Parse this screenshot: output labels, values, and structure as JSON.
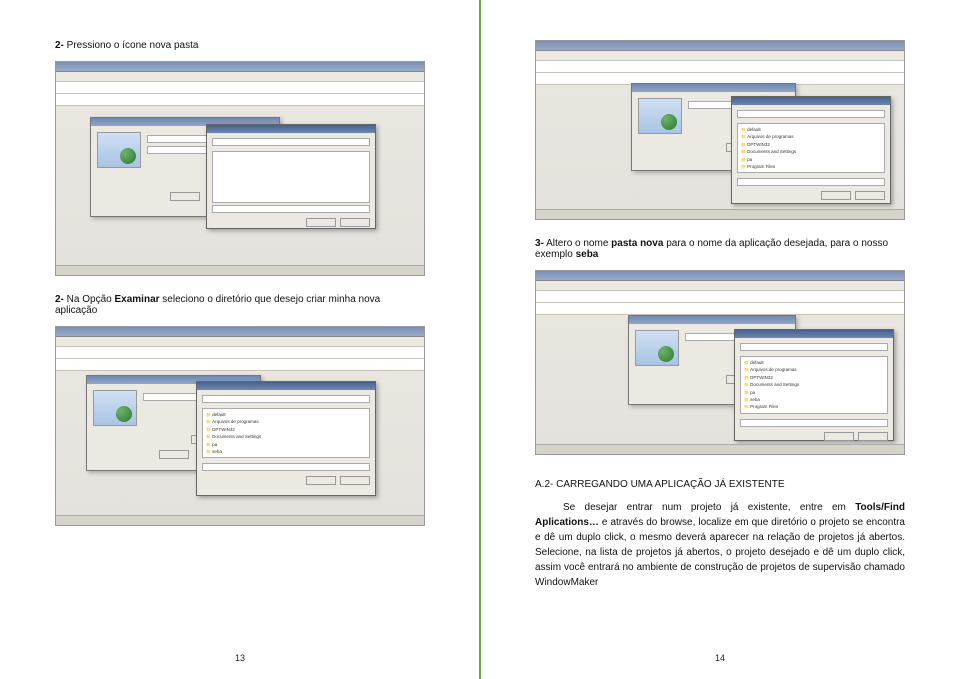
{
  "left": {
    "step2": {
      "num": "2-",
      "text": " Pressiono o ícone nova pasta"
    },
    "step2b_prefix": "2-",
    "step2b_mid1": " Na Opção ",
    "step2b_bold": "Examinar",
    "step2b_mid2": " seleciono o diretório que desejo criar minha nova aplicação",
    "page_num": "13"
  },
  "right": {
    "step3_prefix": "3-",
    "step3_mid1": " Altero o nome ",
    "step3_bold1": "pasta nova",
    "step3_mid2": " para o nome da aplicação desejada, para o nosso exemplo ",
    "step3_bold2": "seba",
    "section_heading": "A.2- CARREGANDO UMA APLICAÇÃO JÁ EXISTENTE",
    "paragraph_p1": "Se desejar entrar num projeto já existente, entre em ",
    "paragraph_b1": "Tools/Find Aplications…",
    "paragraph_p2": " e através do browse, localize em que diretório o projeto se encontra e dê um duplo click, o mesmo deverá aparecer na relação de projetos já abertos. Selecione, na lista de projetos já abertos, o projeto desejado e dê um duplo click, assim você entrará no ambiente de construção de projetos de supervisão chamado WindowMaker",
    "page_num": "14"
  },
  "dir_list": {
    "items": [
      "default",
      "Arquivos de programas",
      "DPTWIN32",
      "Documents and Settings",
      "pa",
      "seba",
      "Program Files"
    ]
  }
}
